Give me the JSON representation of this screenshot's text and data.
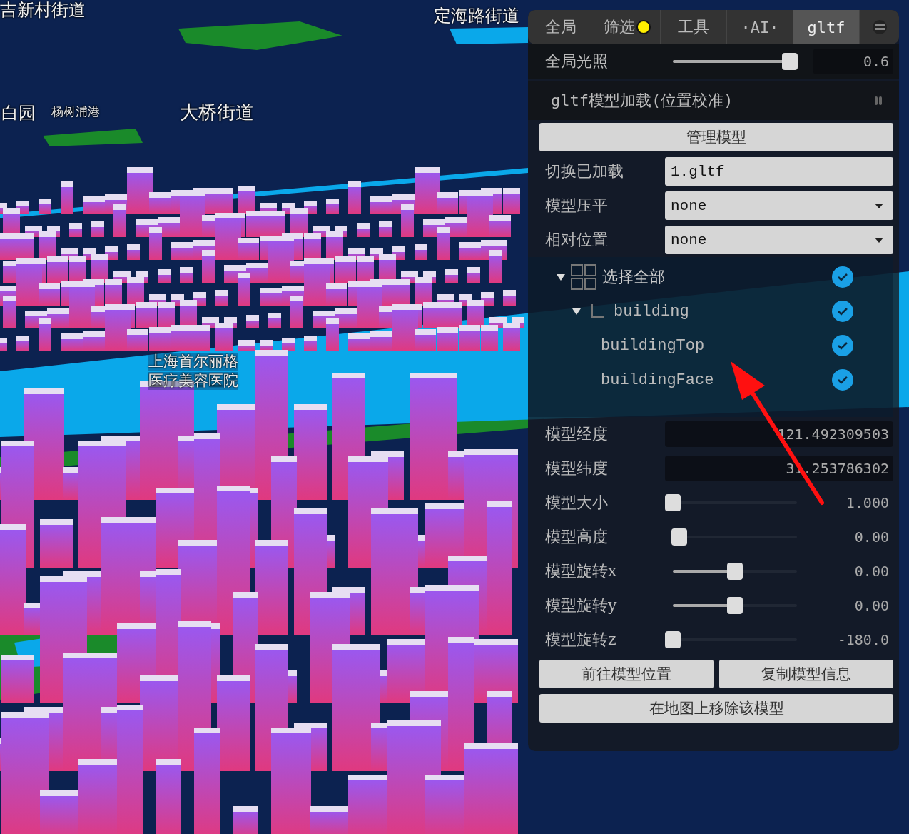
{
  "map": {
    "labels": [
      {
        "text": "吉新村街道",
        "kind": "district"
      },
      {
        "text": "定海路街道",
        "kind": "district"
      },
      {
        "text": "白园",
        "kind": "district"
      },
      {
        "text": "杨树浦港",
        "kind": "poi"
      },
      {
        "text": "大桥街道",
        "kind": "district"
      },
      {
        "text": "上海首尔丽格",
        "kind": "poi"
      },
      {
        "text": "医疗美容医院",
        "kind": "poi"
      }
    ]
  },
  "panel": {
    "tabs": [
      {
        "label": "全局",
        "selected": false,
        "indicator": false
      },
      {
        "label": "筛选",
        "selected": false,
        "indicator": true
      },
      {
        "label": "工具",
        "selected": false,
        "indicator": false
      },
      {
        "label": "·AI·",
        "selected": false,
        "indicator": false
      },
      {
        "label": "gltf",
        "selected": true,
        "indicator": false
      }
    ],
    "global_light": {
      "label": "全局光照",
      "level": 0.94,
      "value": "0.6"
    },
    "folder": {
      "title": "gltf模型加载(位置校准)",
      "controls": [
        {
          "kind": "button",
          "label": "管理模型"
        },
        {
          "kind": "text",
          "label": "切换已加载",
          "value": "1.gltf"
        },
        {
          "kind": "select",
          "label": "模型压平",
          "value": "none"
        },
        {
          "kind": "select",
          "label": "相对位置",
          "value": "none"
        },
        {
          "kind": "tree",
          "items": [
            {
              "label": "选择全部",
              "expanded": true,
              "checked": true,
              "children": [
                {
                  "label": "building",
                  "expanded": true,
                  "checked": true,
                  "children": [
                    {
                      "label": "buildingTop",
                      "checked": true
                    },
                    {
                      "label": "buildingFace",
                      "checked": true
                    }
                  ]
                }
              ]
            }
          ]
        },
        {
          "kind": "number",
          "label": "模型经度",
          "value": "121.492309503"
        },
        {
          "kind": "number",
          "label": "模型纬度",
          "value": "31.253786302"
        },
        {
          "kind": "slider",
          "label": "模型大小",
          "level": 0,
          "value": "1.000"
        },
        {
          "kind": "slider",
          "label": "模型高度",
          "level": 0.05,
          "value": "0.00"
        },
        {
          "kind": "slider",
          "label": "模型旋转x",
          "level": 0.5,
          "value": "0.00"
        },
        {
          "kind": "slider",
          "label": "模型旋转y",
          "level": 0.5,
          "value": "0.00"
        },
        {
          "kind": "slider",
          "label": "模型旋转z",
          "level": 0,
          "value": "-180.0"
        },
        {
          "kind": "button_pair",
          "buttons": [
            "前往模型位置",
            "复制模型信息"
          ]
        },
        {
          "kind": "button",
          "label": "在地图上移除该模型"
        }
      ]
    }
  }
}
